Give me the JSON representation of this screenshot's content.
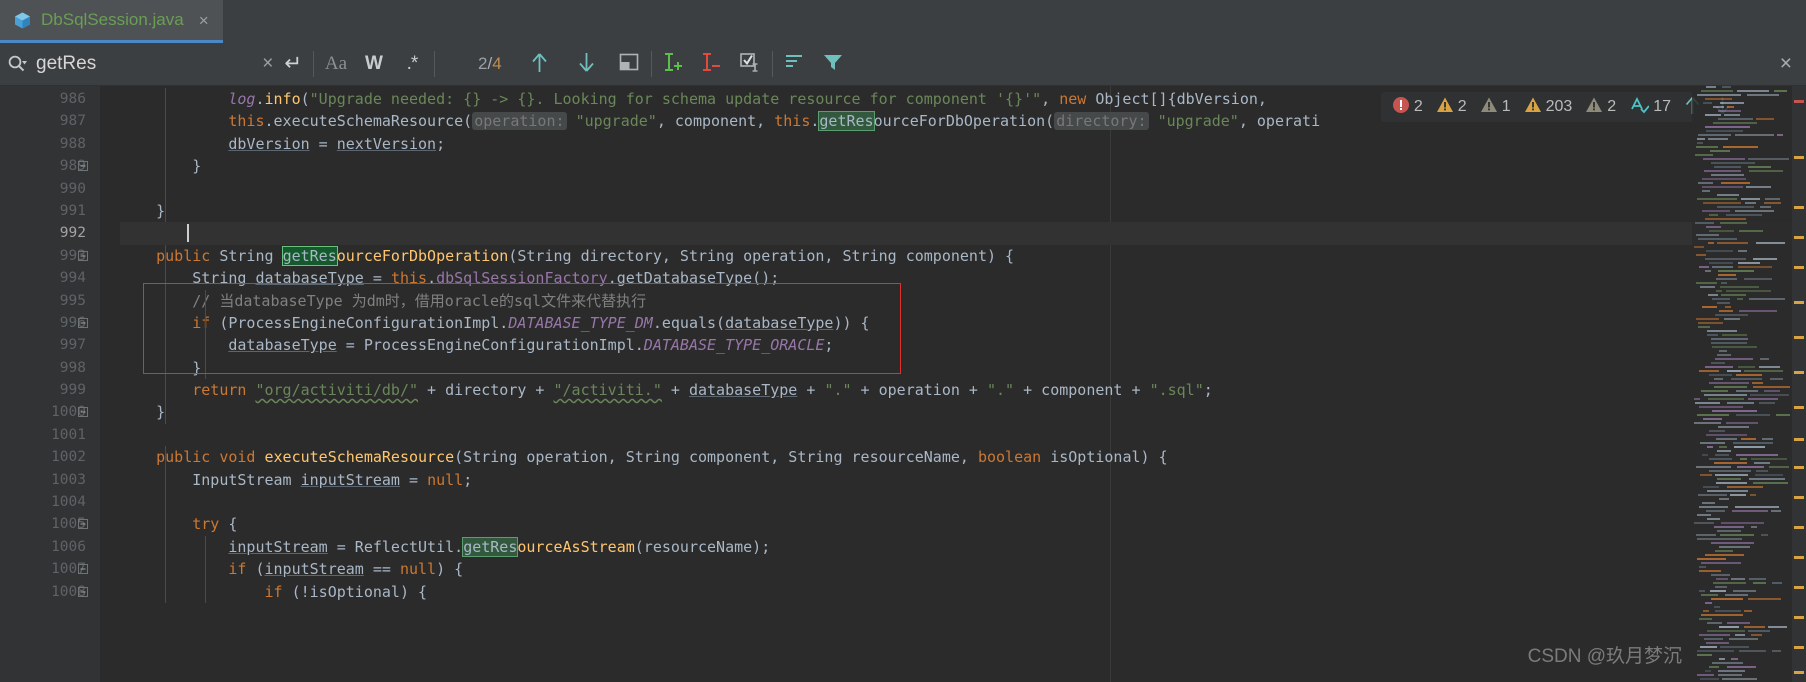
{
  "window": {
    "tab": {
      "label": "DbSqlSession.java",
      "close": "×",
      "icon": "java-class-icon"
    }
  },
  "search": {
    "magnifier_icon": "search-icon",
    "value": "getRes",
    "placeholder": "",
    "clear_label": "×",
    "enter_label": "↵",
    "match_case_label": "Aa",
    "words_label": "W",
    "regex_label": ".*",
    "match_current": "2",
    "match_separator": "/",
    "match_total": "4",
    "counter_text": "2/4",
    "prev_icon": "arrow-up-icon",
    "next_icon": "arrow-down-icon",
    "select_all_icon": "open-in-new-window-icon",
    "add_selection_icon": "add-selection-icon",
    "remove_selection_icon": "remove-selection-icon",
    "select_all_occurrences_icon": "select-all-occurrences-icon",
    "filter_lines_icon": "filter-lines-icon",
    "filter_icon": "filter-icon",
    "close_label": "×"
  },
  "inspections": {
    "items": [
      {
        "icon": "error-icon",
        "color": "#c75450",
        "count": "2"
      },
      {
        "icon": "warning-icon",
        "color": "#d9a343",
        "count": "2"
      },
      {
        "icon": "weak-warning-icon",
        "color": "#8f8b7b",
        "count": "1"
      },
      {
        "icon": "warning-icon",
        "color": "#d9a343",
        "count": "203"
      },
      {
        "icon": "weak-warning-icon",
        "color": "#8f8b7b",
        "count": "2"
      },
      {
        "icon": "typo-icon",
        "color": "#4fc3c7",
        "count": "17"
      }
    ],
    "prev_icon": "arrow-up-icon",
    "next_icon": "arrow-down-icon"
  },
  "editor": {
    "first_line": 986,
    "current_line": 992,
    "lines": [
      {
        "n": "986",
        "fold": "",
        "html": "            <span class=\"logvar\">log</span>.<span class=\"mth\">info</span>(<span class=\"str\">\"Upgrade needed: {} -&gt; {}. Looking for schema update resource for component '{}'\"</span>, <span class=\"kw\">new</span> Object[]{dbVersion,"
      },
      {
        "n": "987",
        "fold": "",
        "html": "            <span class=\"kw\">this</span>.executeSchemaResource(<span class=\"param-hint\">operation:</span> <span class=\"str\">\"upgrade\"</span>, component, <span class=\"kw\">this</span>.<span class=\"hl\">getRes</span>ourceForDbOperation(<span class=\"param-hint\">directory:</span> <span class=\"str\">\"upgrade\"</span>, operati"
      },
      {
        "n": "988",
        "fold": "",
        "html": "            <span class=\"loc\">dbVersion</span> = <span class=\"loc\">nextVersion</span>;"
      },
      {
        "n": "989",
        "fold": "−",
        "html": "        }"
      },
      {
        "n": "990",
        "fold": "",
        "html": ""
      },
      {
        "n": "991",
        "fold": "",
        "html": "    }"
      },
      {
        "n": "992",
        "fold": "",
        "html": ""
      },
      {
        "n": "993",
        "fold": "−",
        "html": "    <span class=\"kw\">public</span> String <span class=\"hl-cur\">getRes</span><span class=\"mth\">ourceForDbOperation</span>(String directory, String operation, String component) {"
      },
      {
        "n": "994",
        "fold": "",
        "html": "        String <span class=\"loc\">databaseType</span> = <span class=\"kw\">this</span>.<span class=\"fld\">dbSqlSessionFactory</span>.getDatabaseType();"
      },
      {
        "n": "995",
        "fold": "",
        "html": "        <span class=\"cmt\">// 当databaseType 为dm时，借用oracle的sql文件来代替执行</span>"
      },
      {
        "n": "996",
        "fold": "−",
        "html": "        <span class=\"kw\">if</span> (ProcessEngineConfigurationImpl.<span class=\"stat\">DATABASE_TYPE_DM</span>.equals(<span class=\"loc\">databaseType</span>)) {"
      },
      {
        "n": "997",
        "fold": "",
        "html": "            <span class=\"loc\">databaseType</span> = ProcessEngineConfigurationImpl.<span class=\"stat\">DATABASE_TYPE_ORACLE</span>;"
      },
      {
        "n": "998",
        "fold": "",
        "html": "        }"
      },
      {
        "n": "999",
        "fold": "",
        "html": "        <span class=\"kw\">return</span> <span class=\"str squiggle\">\"org/activiti/db/\"</span> + directory + <span class=\"str squiggle\">\"/activiti.\"</span> + <span class=\"loc\">databaseType</span> + <span class=\"str\">\".\"</span> + operation + <span class=\"str\">\".\"</span> + component + <span class=\"str\">\".sql\"</span>;"
      },
      {
        "n": "1000",
        "fold": "−",
        "html": "    }"
      },
      {
        "n": "1001",
        "fold": "",
        "html": ""
      },
      {
        "n": "1002",
        "fold": "",
        "html": "    <span class=\"kw\">public</span> <span class=\"kw\">void</span> <span class=\"mth\">executeSchemaResource</span>(String operation, String component, String resourceName, <span class=\"kw\">boolean</span> isOptional) {"
      },
      {
        "n": "1003",
        "fold": "",
        "html": "        InputStream <span class=\"loc\">inputStream</span> = <span class=\"kw\">null</span>;"
      },
      {
        "n": "1004",
        "fold": "",
        "html": ""
      },
      {
        "n": "1005",
        "fold": "−",
        "html": "        <span class=\"kw\">try</span> {"
      },
      {
        "n": "1006",
        "fold": "",
        "html": "            <span class=\"loc\">inputStream</span> = ReflectUtil.<span class=\"hl\">getRes</span><span class=\"mth\">ourceAsStream</span>(resourceName);"
      },
      {
        "n": "1007",
        "fold": "−",
        "html": "            <span class=\"kw\">if</span> (<span class=\"loc\">inputStream</span> == <span class=\"kw\">null</span>) {"
      },
      {
        "n": "1008",
        "fold": "−",
        "html": "                <span class=\"kw\">if</span> (!isOptional) {"
      }
    ],
    "annotation_box": {
      "label": "red-highlight-box",
      "color": "#e03030"
    }
  },
  "watermark": {
    "text": "CSDN @玖月梦沉"
  }
}
